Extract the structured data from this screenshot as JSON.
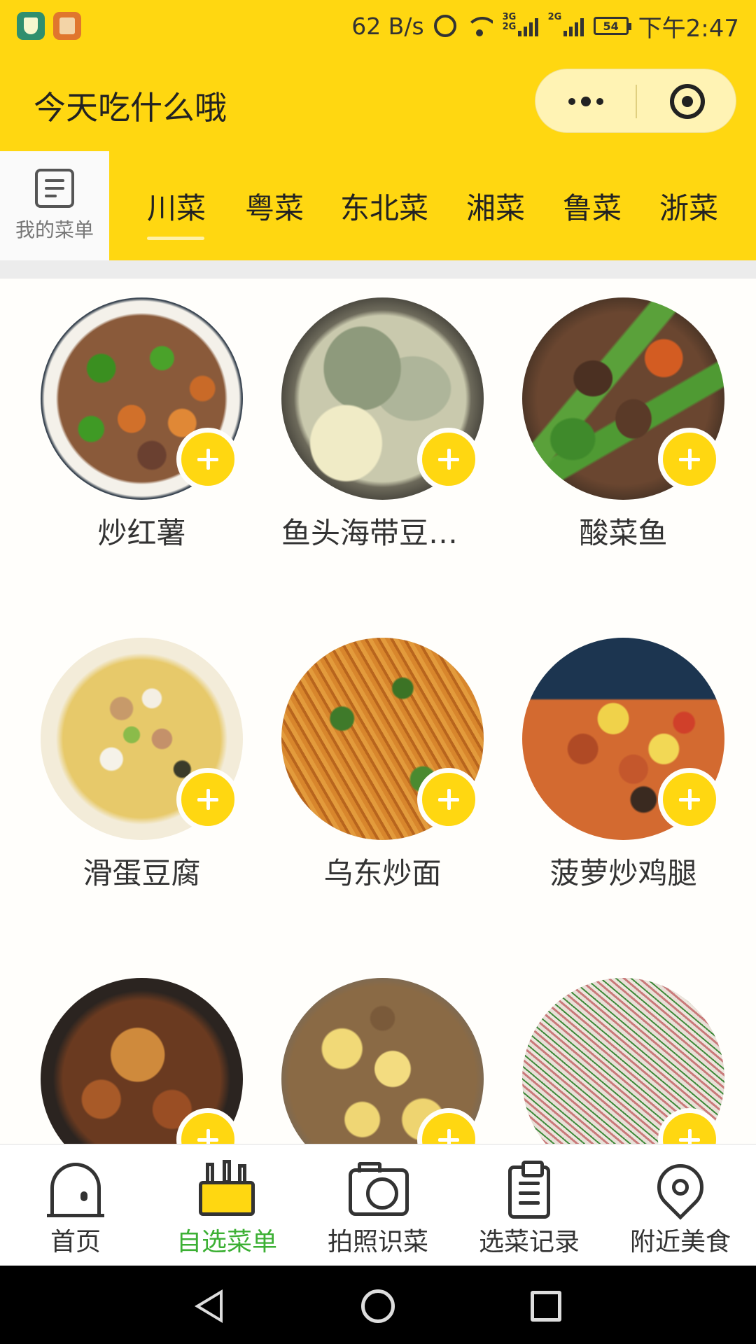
{
  "status_bar": {
    "net_speed": "62 B/s",
    "signal_tag_1": "3G\n2G",
    "signal_tag_2": "2G",
    "battery": "54",
    "time": "下午2:47",
    "left_icons": [
      "shield-app-icon",
      "book-app-icon"
    ]
  },
  "header": {
    "title": "今天吃什么哦",
    "more_icon": "more-dots-icon",
    "close_icon": "target-close-icon"
  },
  "categories": {
    "my_menu_label": "我的菜单",
    "my_menu_icon": "document-icon",
    "tabs": [
      "川菜",
      "粤菜",
      "东北菜",
      "湘菜",
      "鲁菜",
      "浙菜"
    ],
    "active_index": 0
  },
  "dishes": [
    {
      "name": "炒红薯"
    },
    {
      "name": "鱼头海带豆腐…"
    },
    {
      "name": "酸菜鱼"
    },
    {
      "name": "滑蛋豆腐"
    },
    {
      "name": "乌东炒面"
    },
    {
      "name": "菠萝炒鸡腿"
    },
    {
      "name": ""
    },
    {
      "name": ""
    },
    {
      "name": ""
    }
  ],
  "tabbar": {
    "items": [
      {
        "label": "首页",
        "icon": "home-icon"
      },
      {
        "label": "自选菜单",
        "icon": "menu-cup-icon"
      },
      {
        "label": "拍照识菜",
        "icon": "camera-icon"
      },
      {
        "label": "选菜记录",
        "icon": "clipboard-icon"
      },
      {
        "label": "附近美食",
        "icon": "location-pin-icon"
      }
    ],
    "active_index": 1
  },
  "colors": {
    "brand_yellow": "#ffd711",
    "active_green": "#3cb034"
  }
}
